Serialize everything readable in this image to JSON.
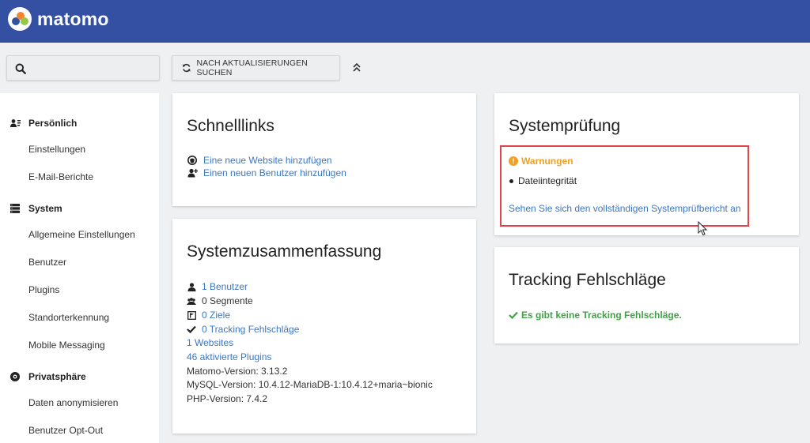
{
  "header": {
    "logo_text": "matomo",
    "bg": "#3450a3"
  },
  "toolbar": {
    "search_icon": "search-icon",
    "update_label": "NACH AKTUALISIERUNGEN SUCHEN",
    "update_icon": "refresh-icon",
    "collapse_icon": "double-chevron-up-icon"
  },
  "sidebar": {
    "sections": [
      {
        "label": "Persönlich",
        "icon": "user-card-icon",
        "items": [
          "Einstellungen",
          "E-Mail-Berichte"
        ]
      },
      {
        "label": "System",
        "icon": "server-icon",
        "items": [
          "Allgemeine Einstellungen",
          "Benutzer",
          "Plugins",
          "Standorterkennung",
          "Mobile Messaging"
        ]
      },
      {
        "label": "Privatsphäre",
        "icon": "eye-icon",
        "items": [
          "Daten anonymisieren",
          "Benutzer Opt-Out"
        ]
      }
    ]
  },
  "quicklinks": {
    "title": "Schnelllinks",
    "links": [
      {
        "label": "Eine neue Website hinzufügen",
        "icon": "globe-icon"
      },
      {
        "label": "Einen neuen Benutzer hinzufügen",
        "icon": "add-user-icon"
      }
    ]
  },
  "summary": {
    "title": "Systemzusammenfassung",
    "rows": [
      {
        "label": "1 Benutzer",
        "icon": "user-icon",
        "link": true
      },
      {
        "label": "0 Segmente",
        "icon": "segments-icon",
        "link": false
      },
      {
        "label": "0 Ziele",
        "icon": "flag-icon",
        "link": true
      },
      {
        "label": "0 Tracking Fehlschläge",
        "icon": "check-icon",
        "link": true
      },
      {
        "label": "1 Websites",
        "icon": "",
        "link": true
      },
      {
        "label": "46 aktivierte Plugins",
        "icon": "",
        "link": true
      },
      {
        "label": "Matomo-Version: 3.13.2",
        "icon": "",
        "link": false
      },
      {
        "label": "MySQL-Version: 10.4.12-MariaDB-1:10.4.12+maria~bionic",
        "icon": "",
        "link": false
      },
      {
        "label": "PHP-Version: 7.4.2",
        "icon": "",
        "link": false
      }
    ]
  },
  "syscheck": {
    "title": "Systemprüfung",
    "warning_label": "Warnungen",
    "warning_icon": "exclamation-circle-icon",
    "warning_color": "#f0a024",
    "items": [
      "Dateiintegrität"
    ],
    "report_link": "Sehen Sie sich den vollständigen Systemprüfbericht an",
    "highlight_color": "#e5434b"
  },
  "tracking": {
    "title": "Tracking Fehlschläge",
    "ok_message": "Es gibt keine Tracking Fehlschläge.",
    "ok_color": "#43a047"
  },
  "colors": {
    "link": "#3c76c2",
    "background": "#eef0f2"
  }
}
